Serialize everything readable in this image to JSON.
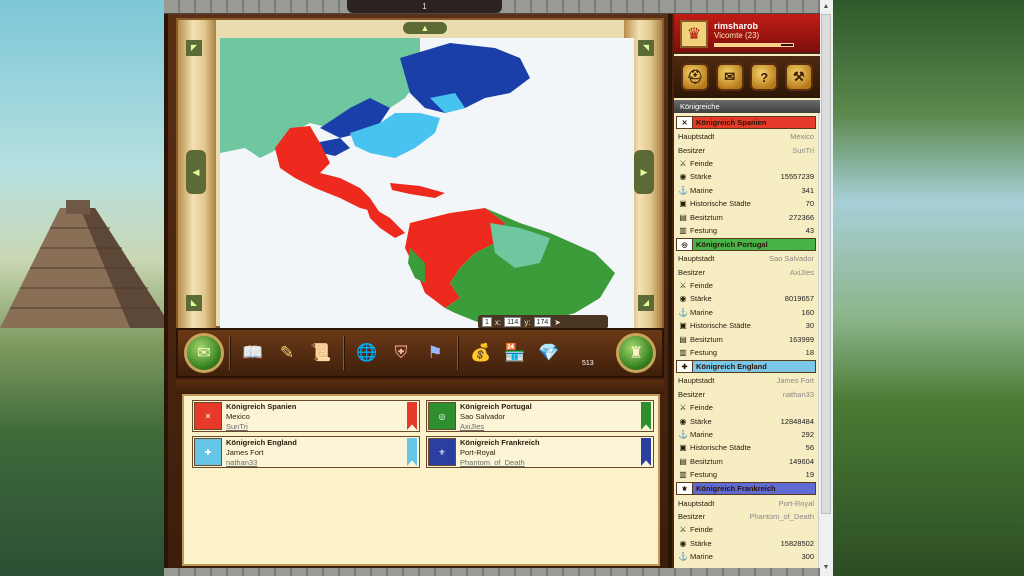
{
  "window": {
    "page_number": "1"
  },
  "player": {
    "name": "rimsharob",
    "rank": "Vicomte (23)",
    "xp_fraction": 0.85
  },
  "sidebar": {
    "buttons": [
      {
        "name": "helmet",
        "icon": "⛑"
      },
      {
        "name": "messages",
        "icon": "✉"
      },
      {
        "name": "help",
        "icon": "?"
      },
      {
        "name": "settings",
        "icon": "⚒"
      }
    ],
    "kingdoms_title": "Königreiche",
    "kingdoms": [
      {
        "name": "Königreich Spanien",
        "color": "#e53a2a",
        "flag": "✕",
        "rows": [
          {
            "label": "Hauptstadt",
            "value": "Mexico",
            "icon": ""
          },
          {
            "label": "Besitzer",
            "value": "SunTri",
            "icon": ""
          },
          {
            "label": "Feinde",
            "value": "",
            "icon": "⚔"
          },
          {
            "label": "Stärke",
            "value": "15557239",
            "icon": "◉"
          },
          {
            "label": "Marine",
            "value": "341",
            "icon": "⚓"
          },
          {
            "label": "Historische Städte",
            "value": "70",
            "icon": "▣"
          },
          {
            "label": "Besitztum",
            "value": "272366",
            "icon": "▤"
          },
          {
            "label": "Festung",
            "value": "43",
            "icon": "▥"
          }
        ]
      },
      {
        "name": "Königreich Portugal",
        "color": "#48b348",
        "flag": "◎",
        "rows": [
          {
            "label": "Hauptstadt",
            "value": "Sao Salvador",
            "icon": ""
          },
          {
            "label": "Besitzer",
            "value": "AxiJIes",
            "icon": ""
          },
          {
            "label": "Feinde",
            "value": "",
            "icon": "⚔"
          },
          {
            "label": "Stärke",
            "value": "8019657",
            "icon": "◉"
          },
          {
            "label": "Marine",
            "value": "160",
            "icon": "⚓"
          },
          {
            "label": "Historische Städte",
            "value": "30",
            "icon": "▣"
          },
          {
            "label": "Besitztum",
            "value": "163999",
            "icon": "▤"
          },
          {
            "label": "Festung",
            "value": "18",
            "icon": "▥"
          }
        ]
      },
      {
        "name": "Königreich England",
        "color": "#7cc7e8",
        "flag": "✚",
        "rows": [
          {
            "label": "Hauptstadt",
            "value": "James Fort",
            "icon": ""
          },
          {
            "label": "Besitzer",
            "value": "nathan33",
            "icon": ""
          },
          {
            "label": "Feinde",
            "value": "",
            "icon": "⚔"
          },
          {
            "label": "Stärke",
            "value": "12848484",
            "icon": "◉"
          },
          {
            "label": "Marine",
            "value": "292",
            "icon": "⚓"
          },
          {
            "label": "Historische Städte",
            "value": "56",
            "icon": "▣"
          },
          {
            "label": "Besitztum",
            "value": "149604",
            "icon": "▤"
          },
          {
            "label": "Festung",
            "value": "19",
            "icon": "▥"
          }
        ]
      },
      {
        "name": "Königreich Frankreich",
        "color": "#5f6ad3",
        "flag": "⚜",
        "rows": [
          {
            "label": "Hauptstadt",
            "value": "Port-Royal",
            "icon": ""
          },
          {
            "label": "Besitzer",
            "value": "Phantom_of_Death",
            "icon": ""
          },
          {
            "label": "Feinde",
            "value": "",
            "icon": "⚔"
          },
          {
            "label": "Stärke",
            "value": "15828502",
            "icon": "◉"
          },
          {
            "label": "Marine",
            "value": "300",
            "icon": "⚓"
          }
        ]
      }
    ]
  },
  "map": {
    "coords": {
      "page": "1",
      "x_label": "x:",
      "x": "114",
      "y_label": "y:",
      "y": "174"
    },
    "colors": {
      "ocean": "#f2f6f9",
      "neutral": "#6fc7a0",
      "spain": "#ee2a1f",
      "portugal": "#3a9d3a",
      "england": "#46c3ee",
      "france": "#1b3fa8"
    }
  },
  "toolbar": {
    "left_button_icon": "map-scroll-icon",
    "right_button_icon": "castle-icon",
    "gem_count": "513"
  },
  "cards": [
    {
      "name": "Königreich Spanien",
      "capital": "Mexico",
      "owner": "SunTri",
      "color": "#e53a2a",
      "flag": "✕"
    },
    {
      "name": "Königreich Portugal",
      "capital": "Sao Salvador",
      "owner": "AxiJIes",
      "color": "#2f8f2f",
      "flag": "◎"
    },
    {
      "name": "Königreich England",
      "capital": "James Fort",
      "owner": "nathan33",
      "color": "#66c6e8",
      "flag": "✚"
    },
    {
      "name": "Königreich Frankreich",
      "capital": "Port-Royal",
      "owner": "Phantom_of_Death",
      "color": "#2a3f9f",
      "flag": "⚜"
    }
  ]
}
